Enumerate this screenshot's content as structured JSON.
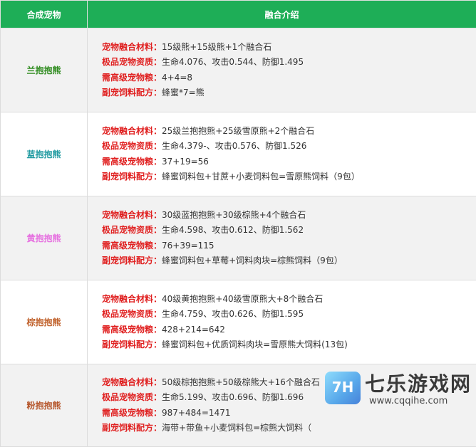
{
  "header": {
    "col1": "合成宠物",
    "col2": "融合介绍"
  },
  "labels": {
    "material": "宠物融合材料：",
    "quality": "极品宠物资质：",
    "food": "需高级宠物粮：",
    "recipe": "副宠饲料配方："
  },
  "rows": [
    {
      "name": "兰抱抱熊",
      "color": "#2e8b1e",
      "material": "15级熊+15级熊+1个融合石",
      "quality": "生命4.076、攻击0.544、防御1.495",
      "food": "4+4=8",
      "recipe": "蜂蜜*7=熊"
    },
    {
      "name": "蓝抱抱熊",
      "color": "#1f9aa0",
      "material": "25级兰抱抱熊+25级雪原熊+2个融合石",
      "quality": "生命4.379-、攻击0.576、防御1.526",
      "food": "37+19=56",
      "recipe": "蜂蜜饲料包+甘蔗+小麦饲料包=雪原熊饲料（9包）"
    },
    {
      "name": "黄抱抱熊",
      "color": "#e66fe0",
      "material": "30级蓝抱抱熊+30级棕熊+4个融合石",
      "quality": "生命4.598、攻击0.612、防御1.562",
      "food": "76+39=115",
      "recipe": "蜂蜜饲料包+草莓+饲料肉块=棕熊饲料（9包）"
    },
    {
      "name": "棕抱抱熊",
      "color": "#c0602a",
      "material": "40级黄抱抱熊+40级雪原熊大+8个融合石",
      "quality": "生命4.759、攻击0.626、防御1.595",
      "food": "428+214=642",
      "recipe": "蜂蜜饲料包+优质饲料肉块=雪原熊大饲料(13包)"
    },
    {
      "name": "粉抱抱熊",
      "color": "#b5552a",
      "material": "50级棕抱抱熊+50级棕熊大+16个融合石",
      "quality": "生命5.199、攻击0.696、防御1.696",
      "food": "987+484=1471",
      "recipe": "海带+带鱼+小麦饲料包=棕熊大饲料（"
    }
  ],
  "watermark": {
    "logo": "7H",
    "title": "七乐游戏网",
    "url": "www.cqqihe.com"
  }
}
